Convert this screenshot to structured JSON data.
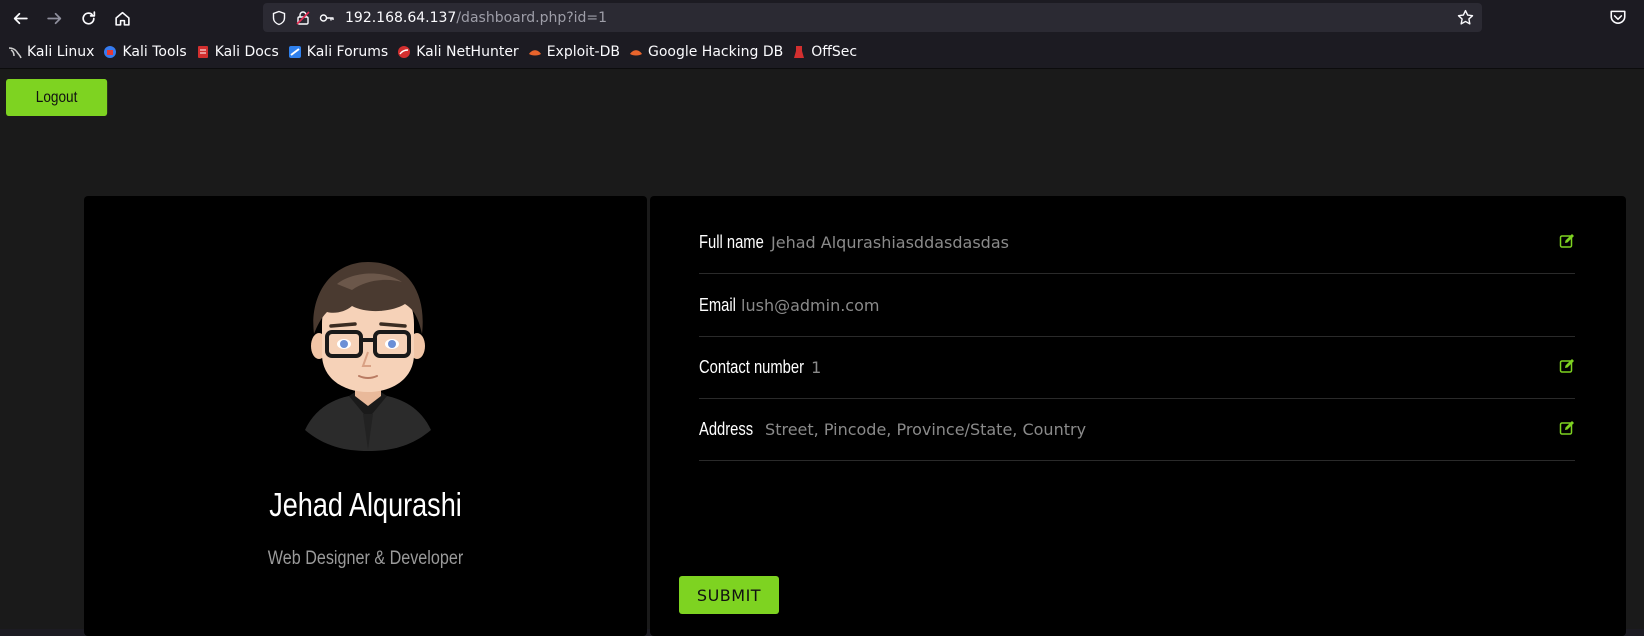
{
  "browser": {
    "url_host": "192.168.64.137",
    "url_path": "/dashboard.php?id=1",
    "bookmarks": [
      {
        "label": "Kali Linux",
        "icon": "kali-dragon-icon",
        "color": "#3a3a3a"
      },
      {
        "label": "Kali Tools",
        "icon": "kali-tools-icon",
        "color": "#367bf0"
      },
      {
        "label": "Kali Docs",
        "icon": "kali-docs-icon",
        "color": "#d32f2f"
      },
      {
        "label": "Kali Forums",
        "icon": "kali-forums-icon",
        "color": "#2f80ed"
      },
      {
        "label": "Kali NetHunter",
        "icon": "nethunter-icon",
        "color": "#d32f2f"
      },
      {
        "label": "Exploit-DB",
        "icon": "exploit-db-icon",
        "color": "#e8642c"
      },
      {
        "label": "Google Hacking DB",
        "icon": "ghdb-icon",
        "color": "#e8642c"
      },
      {
        "label": "OffSec",
        "icon": "offsec-icon",
        "color": "#d32f2f"
      }
    ]
  },
  "page": {
    "logout_label": "Logout",
    "profile": {
      "name": "Jehad Alqurashi",
      "role": "Web Designer & Developer"
    },
    "fields": [
      {
        "label": "Full name",
        "value": "Jehad Alqurashiasddasdasdas",
        "editable": true
      },
      {
        "label": "Email",
        "value": "lush@admin.com",
        "editable": false
      },
      {
        "label": "Contact number",
        "value": "1",
        "editable": true
      },
      {
        "label": "Address",
        "value": "Street, Pincode, Province/State, Country",
        "editable": true
      }
    ],
    "submit_label": "SUBMIT"
  },
  "colors": {
    "accent": "#7ed321",
    "page_bg": "#1a1a1a",
    "card_bg": "#000000"
  }
}
